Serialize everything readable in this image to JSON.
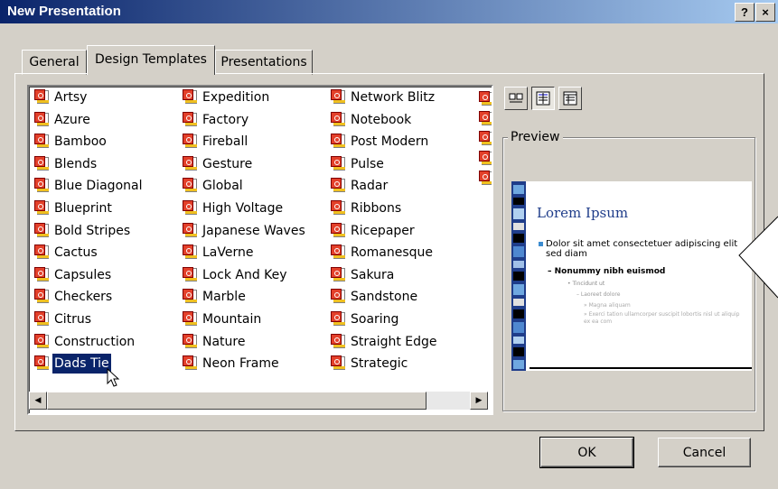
{
  "window": {
    "title": "New Presentation",
    "help_label": "?",
    "close_label": "×"
  },
  "tabs": [
    {
      "label": "General"
    },
    {
      "label": "Design Templates"
    },
    {
      "label": "Presentations"
    }
  ],
  "templates": {
    "columns": [
      [
        "Artsy",
        "Azure",
        "Bamboo",
        "Blends",
        "Blue Diagonal",
        "Blueprint",
        "Bold Stripes",
        "Cactus",
        "Capsules",
        "Checkers",
        "Citrus",
        "Construction",
        "Dads Tie"
      ],
      [
        "Expedition",
        "Factory",
        "Fireball",
        "Gesture",
        "Global",
        "High Voltage",
        "Japanese Waves",
        "LaVerne",
        "Lock And Key",
        "Marble",
        "Mountain",
        "Nature",
        "Neon Frame"
      ],
      [
        "Network Blitz",
        "Notebook",
        "Post Modern",
        "Pulse",
        "Radar",
        "Ribbons",
        "Ricepaper",
        "Romanesque",
        "Sakura",
        "Sandstone",
        "Soaring",
        "Straight Edge",
        "Strategic"
      ]
    ],
    "selected": "Dads Tie",
    "icon": "template-file-icon"
  },
  "view_buttons": [
    {
      "icon": "large-icons-view-icon",
      "pressed": false
    },
    {
      "icon": "list-view-icon",
      "pressed": true
    },
    {
      "icon": "details-view-icon",
      "pressed": false
    }
  ],
  "preview": {
    "label": "Preview",
    "slide_title": "Lorem Ipsum",
    "bullet1": "Dolor sit amet consectetuer adipiscing elit sed diam",
    "bullet2": "– Nonummy nibh euismod",
    "bullet3": "• Tincidunt ut",
    "bullet4": "– Laoreet dolore",
    "bullet5": "» Magna aliquam",
    "bullet6": "» Exerci tation ullamcorper suscipit lobortis nisl ut aliquip ex ea com"
  },
  "buttons": {
    "ok": "OK",
    "cancel": "Cancel"
  },
  "colors": {
    "titlebar_start": "#0a246a",
    "titlebar_end": "#a6caf0",
    "selection": "#0a246a",
    "dialog_bg": "#d4d0c8",
    "slide_title": "#1f3d8a"
  }
}
